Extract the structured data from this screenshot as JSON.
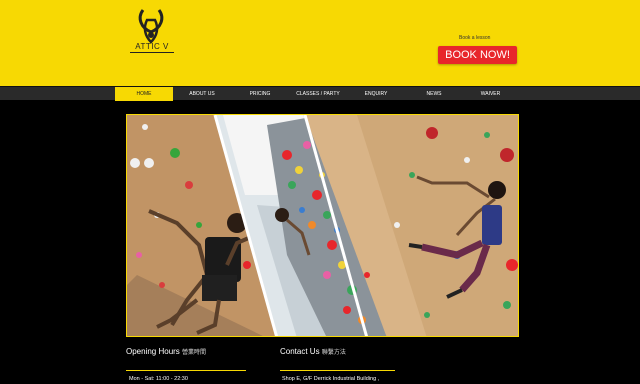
{
  "logo": {
    "text": "ATTIC V",
    "icon": "gazelle-head-icon"
  },
  "booking": {
    "label": "Book a lesson",
    "button": "BOOK NOW!"
  },
  "nav": {
    "items": [
      {
        "label": "HOME",
        "active": true
      },
      {
        "label": "ABOUT US"
      },
      {
        "label": "PRICING"
      },
      {
        "label": "CLASSES / PARTY"
      },
      {
        "label": "ENQUIRY"
      },
      {
        "label": "NEWS"
      },
      {
        "label": "WAIVER"
      }
    ]
  },
  "hours": {
    "title": "Opening Hours",
    "title_cn": "營業時間",
    "line1": "Mon - Sat: 11:00 - 22:30"
  },
  "contact": {
    "title": "Contact Us",
    "title_cn": "聯繫方法",
    "line1": "Shop E, G/F Derrick Industrial Building ,"
  },
  "colors": {
    "brand_yellow": "#f7d903",
    "book_red": "#e8262b",
    "nav_bg": "#2a2a2a"
  }
}
